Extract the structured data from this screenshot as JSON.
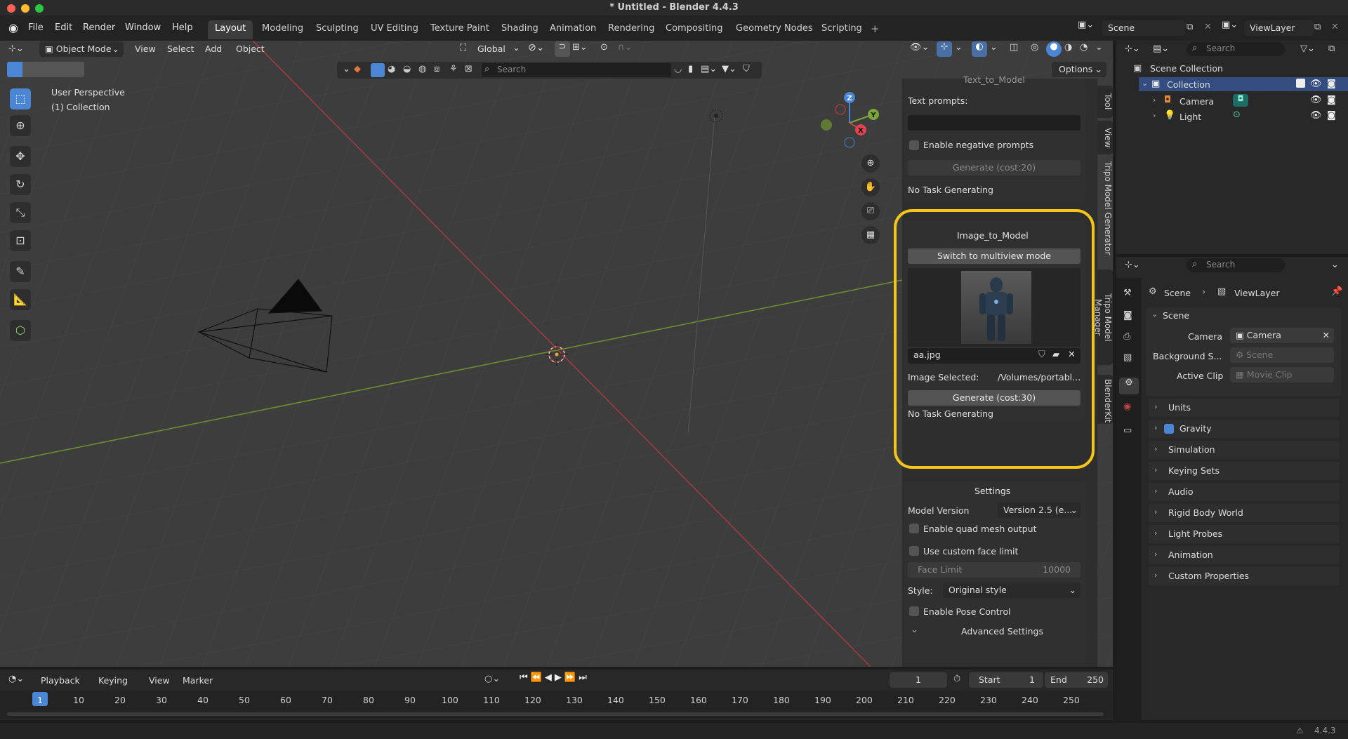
{
  "window": {
    "title": "* Untitled - Blender 4.4.3",
    "version": "4.4.3"
  },
  "menubar": [
    "File",
    "Edit",
    "Render",
    "Window",
    "Help"
  ],
  "workspaces": [
    "Layout",
    "Modeling",
    "Sculpting",
    "UV Editing",
    "Texture Paint",
    "Shading",
    "Animation",
    "Rendering",
    "Compositing",
    "Geometry Nodes",
    "Scripting"
  ],
  "topright": {
    "scene": "Scene",
    "viewlayer": "ViewLayer"
  },
  "viewport_header": {
    "mode": "Object Mode",
    "menus": [
      "View",
      "Select",
      "Add",
      "Object"
    ],
    "transform": "Global",
    "search_placeholder": "Search",
    "options": "Options"
  },
  "viewport": {
    "perspective": "User Perspective",
    "collection": "(1) Collection",
    "gizmo_axes": [
      "Z",
      "Y",
      "X"
    ]
  },
  "sidebar_tabs": [
    "Tool",
    "View",
    "Tripo Model Generator",
    "Tripo Model Manager",
    "BlenderKit"
  ],
  "text_to_model": {
    "title": "Text_to_Model",
    "prompts_label": "Text prompts:",
    "negative_label": "Enable negative prompts",
    "generate": "Generate (cost:20)",
    "status": "No Task Generating"
  },
  "image_to_model": {
    "title": "Image_to_Model",
    "switch_btn": "Switch to multiview mode",
    "filename": "aa.jpg",
    "selected_label": "Image Selected:",
    "selected_path": "/Volumes/portabl...",
    "generate": "Generate (cost:30)",
    "status": "No Task Generating"
  },
  "settings": {
    "title": "Settings",
    "model_version_label": "Model Version",
    "model_version": "Version 2.5 (e...",
    "quad_label": "Enable quad mesh output",
    "custom_face_label": "Use custom face limit",
    "face_limit_label": "Face Limit",
    "face_limit_value": "10000",
    "style_label": "Style:",
    "style_value": "Original style",
    "pose_label": "Enable Pose Control",
    "advanced": "Advanced Settings"
  },
  "outliner": {
    "search_placeholder": "Search",
    "scene_collection": "Scene Collection",
    "collection": "Collection",
    "items": [
      "Camera",
      "Light"
    ]
  },
  "properties": {
    "search_placeholder": "Search",
    "breadcrumb": [
      "Scene",
      "ViewLayer"
    ],
    "scene_section": "Scene",
    "camera_label": "Camera",
    "camera_value": "Camera",
    "background_label": "Background S...",
    "background_placeholder": "Scene",
    "clip_label": "Active Clip",
    "clip_placeholder": "Movie Clip",
    "panels": [
      "Units",
      "Gravity",
      "Simulation",
      "Keying Sets",
      "Audio",
      "Rigid Body World",
      "Light Probes",
      "Animation",
      "Custom Properties"
    ]
  },
  "timeline": {
    "menus": [
      "Playback",
      "Keying",
      "View",
      "Marker"
    ],
    "current_frame": "1",
    "start_label": "Start",
    "start": "1",
    "end_label": "End",
    "end": "250",
    "ruler": [
      "1",
      "10",
      "20",
      "30",
      "40",
      "50",
      "60",
      "70",
      "80",
      "90",
      "100",
      "110",
      "120",
      "130",
      "140",
      "150",
      "160",
      "170",
      "180",
      "190",
      "200",
      "210",
      "220",
      "230",
      "240",
      "250"
    ]
  },
  "colors": {
    "highlight": "#f5c518",
    "accent": "#4a86d4",
    "x_axis": "#c8414b",
    "y_axis": "#7aa53a"
  }
}
